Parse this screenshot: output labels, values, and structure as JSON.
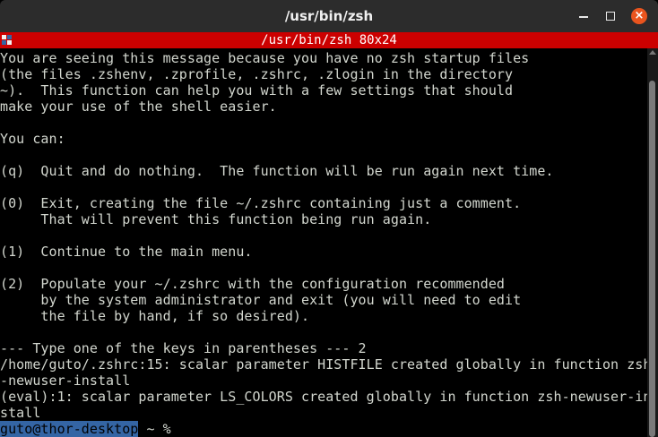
{
  "window": {
    "title": "/usr/bin/zsh"
  },
  "screen": {
    "title": "/usr/bin/zsh 80x24"
  },
  "terminal": {
    "lines": [
      "You are seeing this message because you have no zsh startup files",
      "(the files .zshenv, .zprofile, .zshrc, .zlogin in the directory",
      "~).  This function can help you with a few settings that should",
      "make your use of the shell easier.",
      "",
      "You can:",
      "",
      "(q)  Quit and do nothing.  The function will be run again next time.",
      "",
      "(0)  Exit, creating the file ~/.zshrc containing just a comment.",
      "     That will prevent this function being run again.",
      "",
      "(1)  Continue to the main menu.",
      "",
      "(2)  Populate your ~/.zshrc with the configuration recommended",
      "     by the system administrator and exit (you will need to edit",
      "     the file by hand, if so desired).",
      "",
      "--- Type one of the keys in parentheses --- 2",
      "/home/guto/.zshrc:15: scalar parameter HISTFILE created globally in function zsh",
      "-newuser-install",
      "(eval):1: scalar parameter LS_COLORS created globally in function zsh-newuser-in",
      "stall"
    ],
    "prompt": {
      "host": "guto@thor-desktop",
      "path": " ~ ",
      "symbol": "%"
    }
  },
  "icons": {
    "minimize": "minimize-icon",
    "maximize": "maximize-icon",
    "close": "close-icon",
    "screen": "screen-menu-icon"
  },
  "colors": {
    "titlebar": "#2c2c2c",
    "screenbar": "#cc0000",
    "close_button": "#e9541e",
    "prompt_highlight": "#3465a4",
    "text": "#d3d7cf",
    "background": "#000000"
  }
}
